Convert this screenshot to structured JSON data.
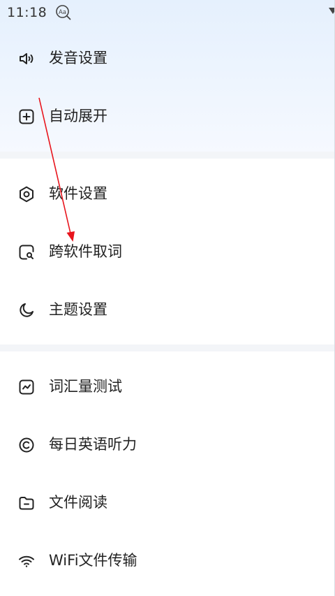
{
  "status_bar": {
    "time": "11:18",
    "app_icon": "aa-magnifier-icon",
    "signal_icon": "signal-icon"
  },
  "menu": {
    "sections": [
      {
        "items": [
          {
            "label": "发音设置",
            "icon": "speaker-icon"
          },
          {
            "label": "自动展开",
            "icon": "plus-square-icon"
          }
        ]
      },
      {
        "items": [
          {
            "label": "软件设置",
            "icon": "hexagon-settings-icon"
          },
          {
            "label": "跨软件取词",
            "icon": "search-square-icon"
          },
          {
            "label": "主题设置",
            "icon": "moon-icon"
          }
        ]
      },
      {
        "items": [
          {
            "label": "词汇量测试",
            "icon": "chart-square-icon"
          },
          {
            "label": "每日英语听力",
            "icon": "circle-c-icon"
          },
          {
            "label": "文件阅读",
            "icon": "folder-icon"
          },
          {
            "label": "WiFi文件传输",
            "icon": "wifi-icon"
          }
        ]
      }
    ]
  },
  "colors": {
    "header_gradient_top": "#e5f0fd",
    "divider": "#f3f5f8",
    "text": "#222222",
    "annotation_arrow": "#e8141c"
  }
}
